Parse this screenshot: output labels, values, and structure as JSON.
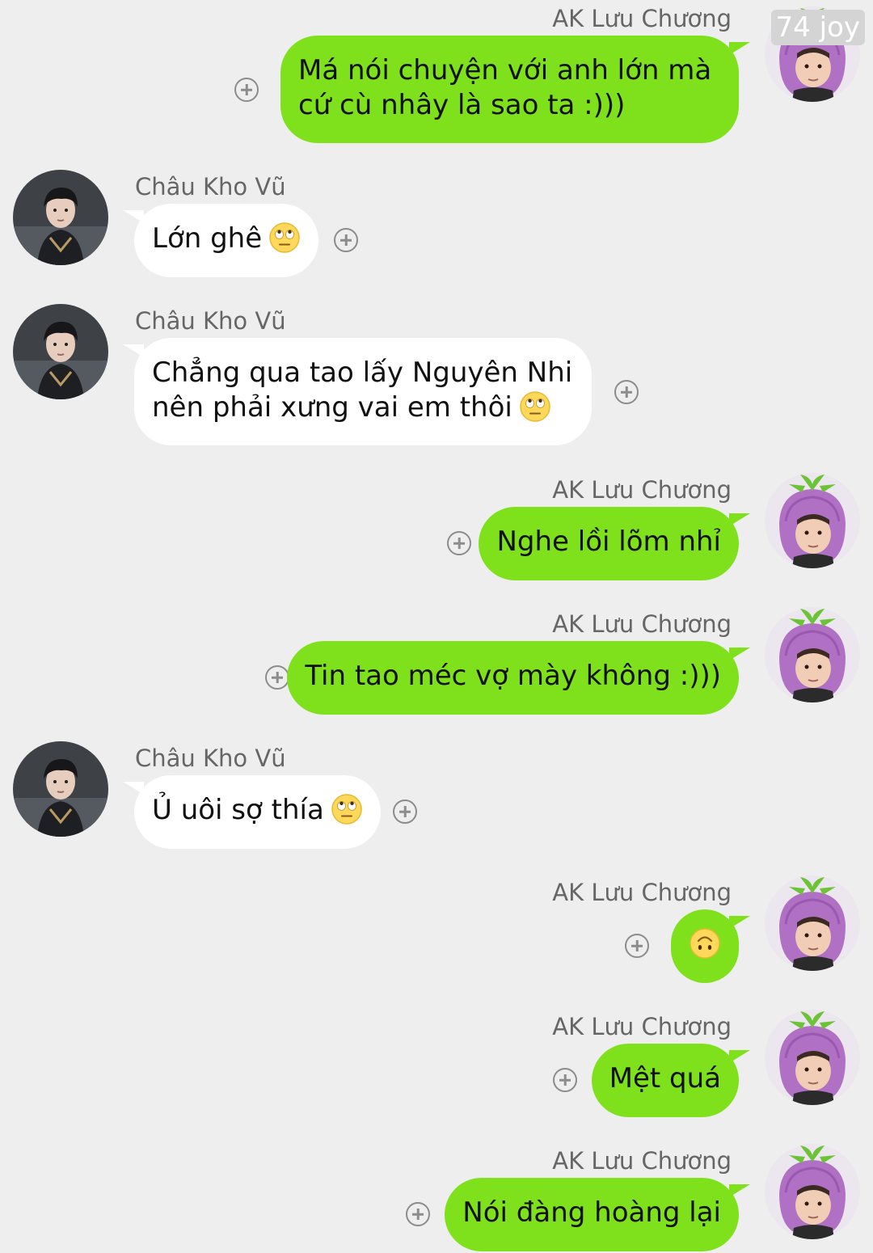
{
  "watermark": "74 joy",
  "colors": {
    "background": "#eeeeee",
    "outgoing_bubble": "#7fe01c",
    "incoming_bubble": "#ffffff"
  },
  "messages": [
    {
      "sender": "AK Lưu Chương",
      "side": "right",
      "lines": [
        "Má nói chuyện với anh lớn mà",
        "cứ cù nhây là sao ta :)))"
      ]
    },
    {
      "sender": "Châu Kho Vũ",
      "side": "left",
      "text": "Lớn ghê",
      "emoji": "eye-roll-emoji"
    },
    {
      "sender": "Châu Kho Vũ",
      "side": "left",
      "lines": [
        "Chẳng qua tao lấy Nguyên Nhi",
        "nên phải xưng vai em thôi"
      ],
      "emoji": "eye-roll-emoji"
    },
    {
      "sender": "AK Lưu Chương",
      "side": "right",
      "text": "Nghe lồi lõm nhỉ"
    },
    {
      "sender": "AK Lưu Chương",
      "side": "right",
      "text": "Tin tao méc vợ mày không :)))"
    },
    {
      "sender": "Châu Kho Vũ",
      "side": "left",
      "text": "Ủ uôi sợ thía",
      "emoji": "eye-roll-emoji"
    },
    {
      "sender": "AK Lưu Chương",
      "side": "right",
      "text": "",
      "emoji": "upside-down-face-emoji"
    },
    {
      "sender": "AK Lưu Chương",
      "side": "right",
      "text": "Mệt quá"
    },
    {
      "sender": "AK Lưu Chương",
      "side": "right",
      "text": "Nói đàng hoàng lại"
    }
  ]
}
